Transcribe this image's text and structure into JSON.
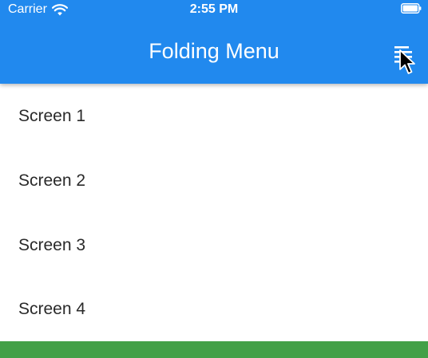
{
  "status_bar": {
    "carrier": "Carrier",
    "time": "2:55 PM",
    "icons": [
      "wifi-icon",
      "battery-icon"
    ]
  },
  "app_bar": {
    "title": "Folding Menu",
    "menu_icon": "menu-icon",
    "color": "#2189EE"
  },
  "list": {
    "items": [
      {
        "label": "Screen 1"
      },
      {
        "label": "Screen 2"
      },
      {
        "label": "Screen 3"
      },
      {
        "label": "Screen 4"
      }
    ]
  },
  "bottom_bar": {
    "color": "#43A047"
  },
  "cursor": "pointer-cursor-icon"
}
